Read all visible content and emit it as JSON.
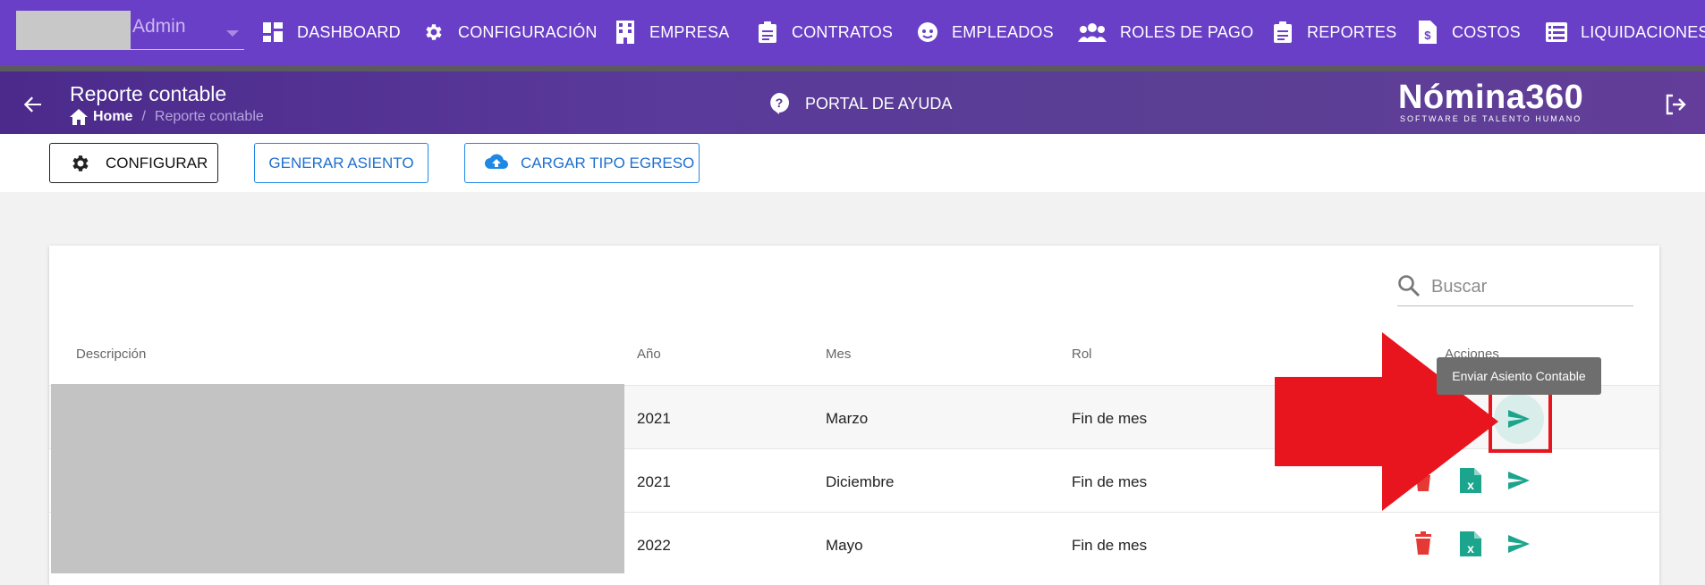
{
  "topnav": {
    "user": {
      "name": "Admin"
    },
    "items": [
      {
        "label": "DASHBOARD",
        "icon": "dashboard-icon"
      },
      {
        "label": "CONFIGURACIÓN",
        "icon": "gear-icon"
      },
      {
        "label": "EMPRESA",
        "icon": "building-icon"
      },
      {
        "label": "CONTRATOS",
        "icon": "clipboard-icon"
      },
      {
        "label": "EMPLEADOS",
        "icon": "face-icon"
      },
      {
        "label": "ROLES DE PAGO",
        "icon": "people-icon"
      },
      {
        "label": "REPORTES",
        "icon": "clipboard-icon"
      },
      {
        "label": "COSTOS",
        "icon": "dollar-file-icon"
      },
      {
        "label": "LIQUIDACIONES",
        "icon": "list-icon"
      }
    ]
  },
  "header": {
    "title": "Reporte contable",
    "breadcrumb": {
      "home": "Home",
      "current": "Reporte contable"
    },
    "help_label": "PORTAL DE AYUDA",
    "logo": {
      "title": "Nómina360",
      "subtitle": "SOFTWARE DE TALENTO HUMANO"
    }
  },
  "toolbar": {
    "configurar": "CONFIGURAR",
    "generar": "GENERAR ASIENTO",
    "cargar": "CARGAR TIPO EGRESO"
  },
  "search": {
    "placeholder": "Buscar"
  },
  "table": {
    "headers": {
      "descripcion": "Descripción",
      "anio": "Año",
      "mes": "Mes",
      "rol": "Rol",
      "acciones": "Acciones"
    },
    "rows": [
      {
        "anio": "2021",
        "mes": "Marzo",
        "rol": "Fin de mes"
      },
      {
        "anio": "2021",
        "mes": "Diciembre",
        "rol": "Fin de mes"
      },
      {
        "anio": "2022",
        "mes": "Mayo",
        "rol": "Fin de mes"
      }
    ]
  },
  "tooltip": "Enviar Asiento Contable",
  "colors": {
    "nav": "#6a3fc7",
    "accent_blue": "#1e88e5",
    "action_teal": "#1aa58c",
    "delete_red": "#e53935",
    "annotation_red": "#e8151f"
  }
}
